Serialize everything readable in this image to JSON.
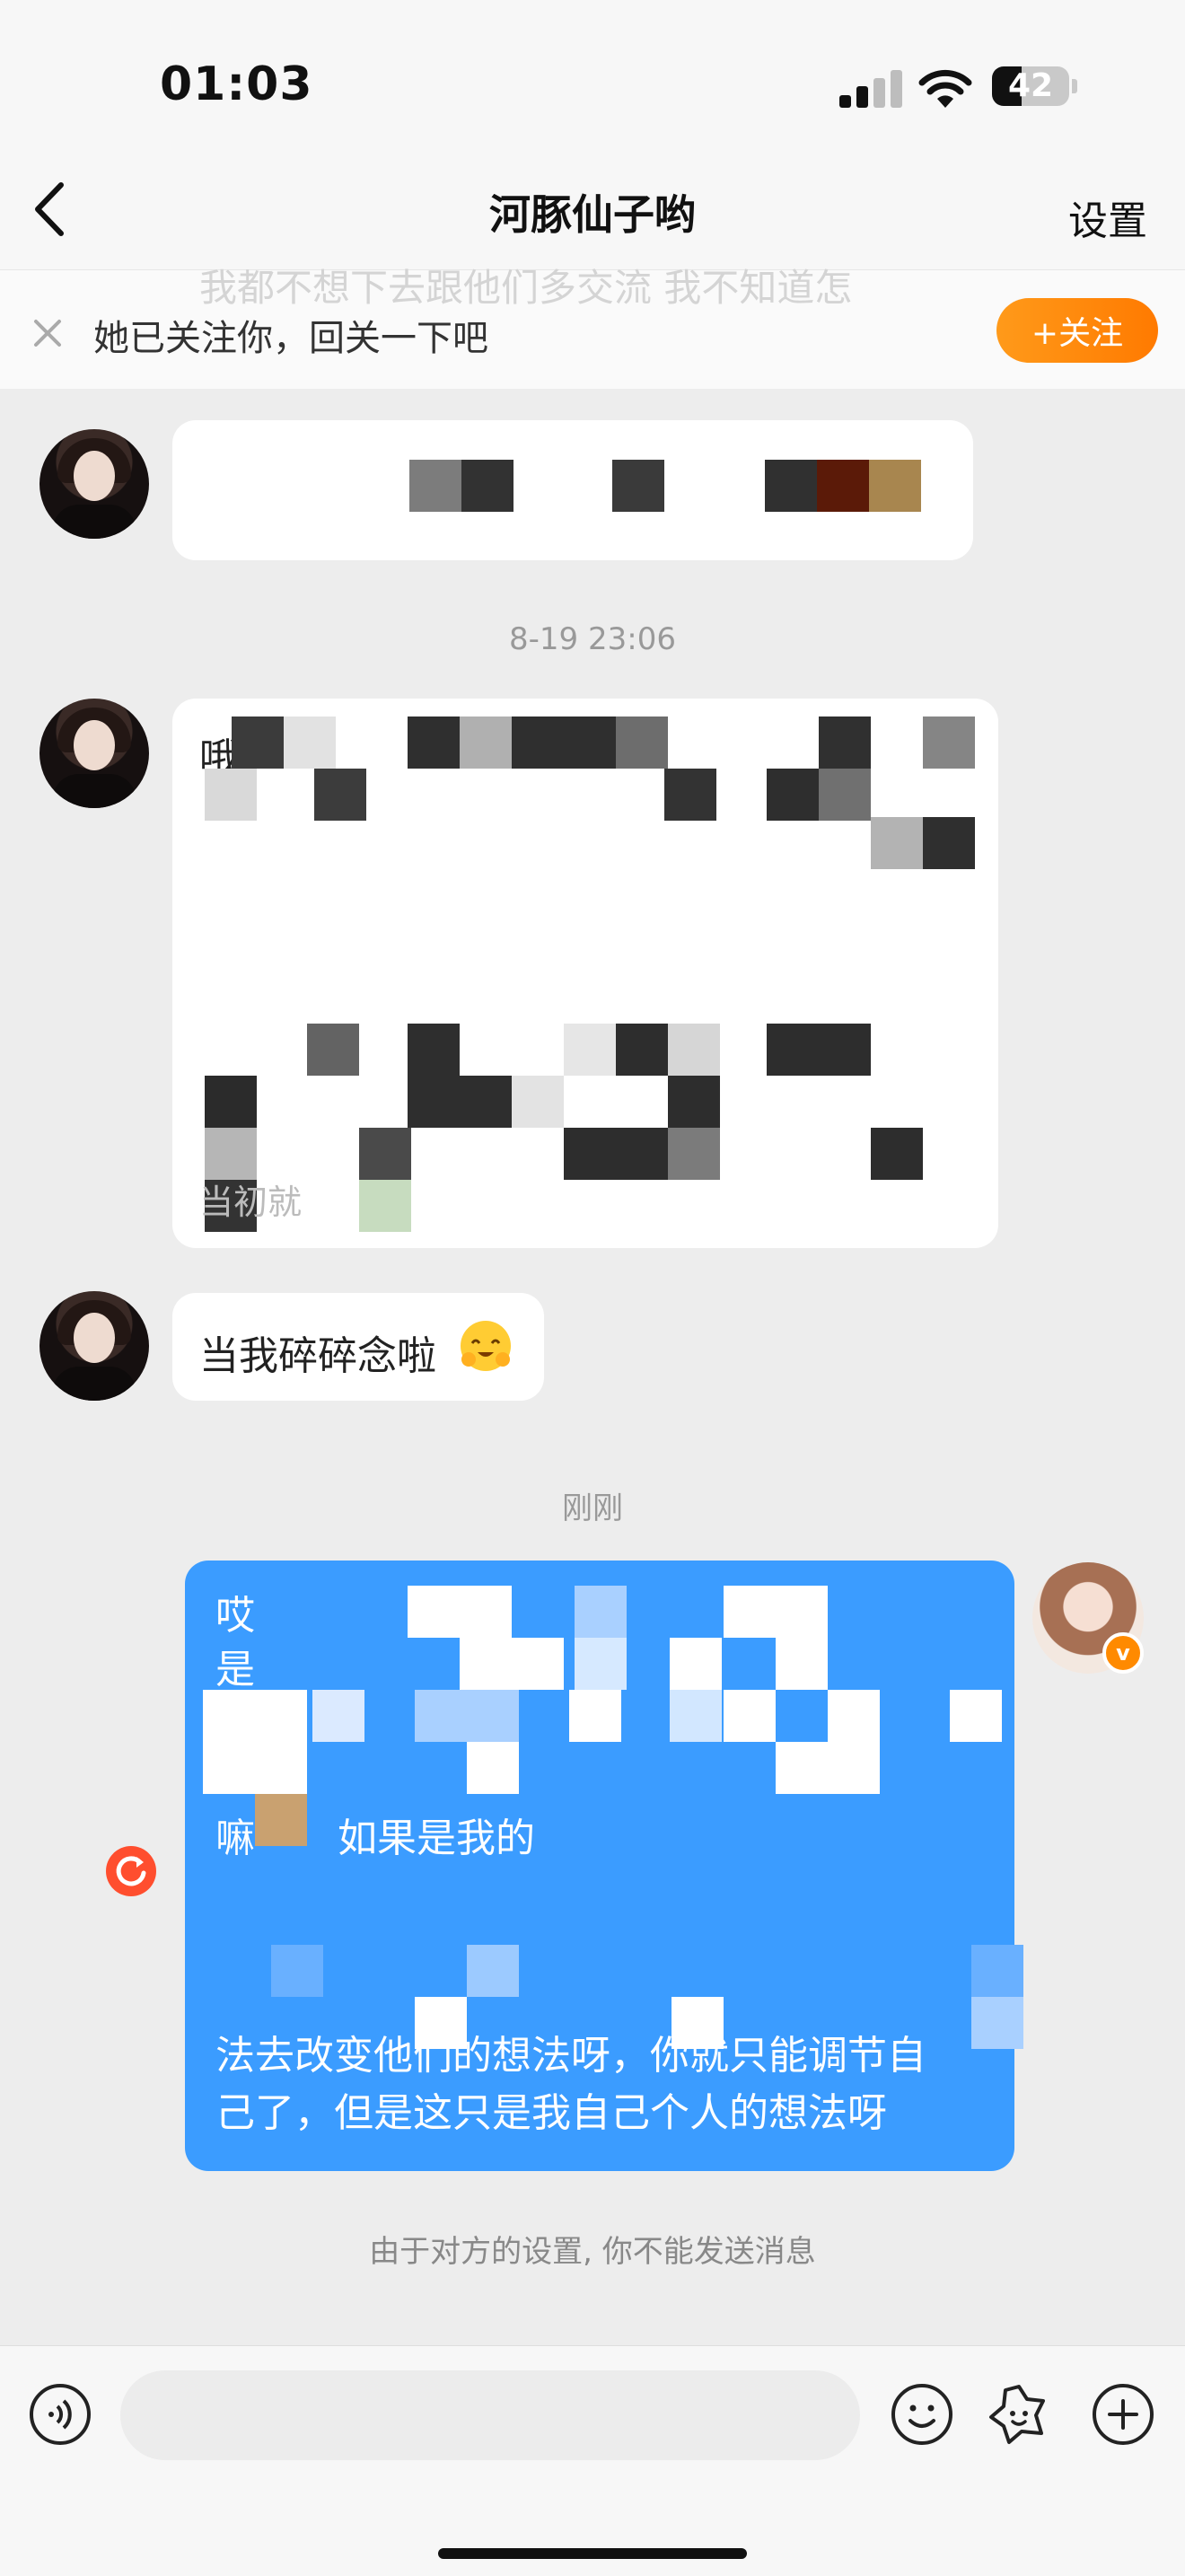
{
  "status_bar": {
    "time": "01:03",
    "battery": "42"
  },
  "nav": {
    "title": "河豚仙子哟",
    "settings_label": "设置"
  },
  "banner": {
    "text": "她已关注你，回关一下吧",
    "ghost_text": "我都不想下去跟他们多交流 我不知道怎",
    "follow_label": "+关注"
  },
  "messages": [
    {
      "side": "left",
      "text": ""
    },
    {
      "timestamp": "8-19 23:06"
    },
    {
      "side": "left",
      "first_char": "哦",
      "last_fragment": "当初就"
    },
    {
      "side": "left",
      "text": "当我碎碎念啦",
      "emoji": "hugging-face-emoji"
    },
    {
      "timestamp": "刚刚"
    },
    {
      "side": "right",
      "first_char": "哎",
      "second_line_start": "是",
      "middle_fragment": "嘛",
      "middle_fragment_end": "如果是我的",
      "end_line_1": "法去改变他们的想法呀，你就只能调节自",
      "end_line_2": "己了，但是这只是我自己个人的想法呀",
      "status": "failed"
    }
  ],
  "notice": "由于对方的设置, 你不能发送消息",
  "toolbar": [
    "voice-icon",
    "emoji-icon",
    "sticker-icon",
    "plus-icon"
  ],
  "colors": {
    "sent_bubble": "#3b9cff",
    "follow_button": "#ff8c10",
    "error_icon": "#ff4e2e"
  }
}
